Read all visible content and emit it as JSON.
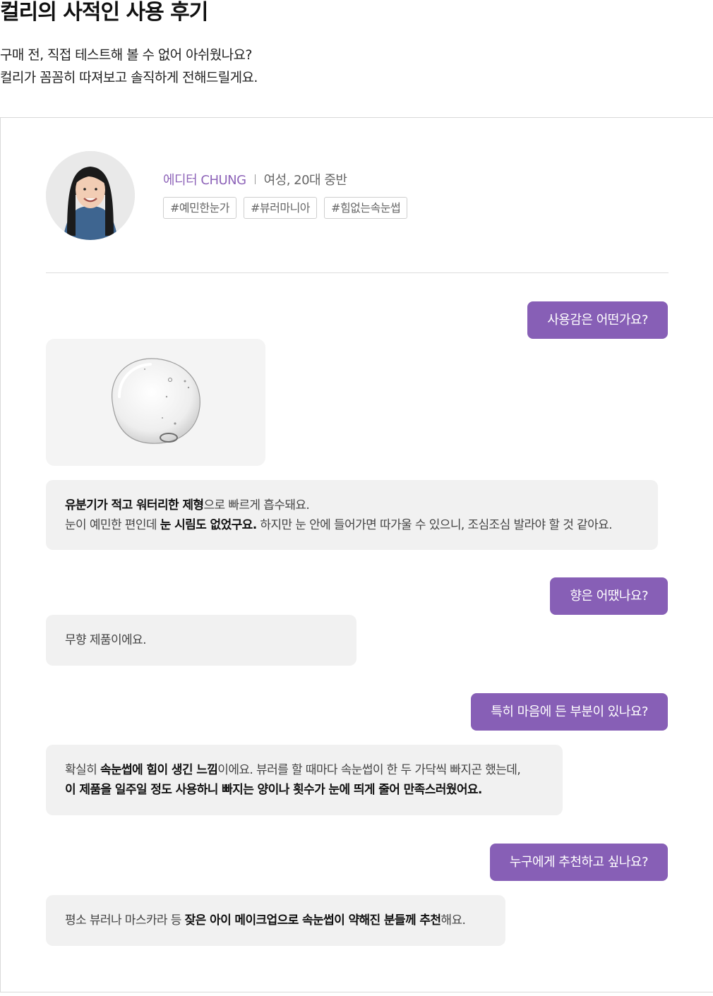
{
  "header": {
    "title": "컬리의 사적인 사용 후기",
    "intro_line1": "구매 전, 직접 테스트해 볼 수 없어 아쉬웠나요?",
    "intro_line2": "컬리가 꼼꼼히 따져보고 솔직하게 전해드릴게요."
  },
  "profile": {
    "name": "에디터 CHUNG",
    "meta": "여성, 20대 중반",
    "tags": [
      "#예민한눈가",
      "#뷰러마니아",
      "#힘없는속눈썹"
    ]
  },
  "colors": {
    "accent": "#875fb6",
    "answer_bg": "#f1f1f1",
    "name_color": "#8e64b9"
  },
  "qa": [
    {
      "question": "사용감은 어떤가요?",
      "answer": [
        [
          {
            "text": "유분기가 적고 워터리한 제형",
            "bold": true
          },
          {
            "text": "으로 빠르게 흡수돼요.",
            "bold": false
          }
        ],
        [
          {
            "text": "눈이 예민한 편인데 ",
            "bold": false
          },
          {
            "text": "눈 시림도 없었구요.",
            "bold": true
          },
          {
            "text": " 하지만 눈 안에 들어가면 따가울 수 있으니, 조심조심 발라야 할 것 같아요.",
            "bold": false
          }
        ]
      ]
    },
    {
      "question": "향은 어땠나요?",
      "answer": [
        [
          {
            "text": "무향 제품이에요.",
            "bold": false
          }
        ]
      ]
    },
    {
      "question": "특히 마음에 든 부분이 있나요?",
      "answer": [
        [
          {
            "text": "확실히 ",
            "bold": false
          },
          {
            "text": "속눈썹에 힘이 생긴 느낌",
            "bold": true
          },
          {
            "text": "이에요. 뷰러를 할 때마다 속눈썹이 한 두 가닥씩 빠지곤 했는데,",
            "bold": false
          }
        ],
        [
          {
            "text": "이 제품을 일주일 정도 사용하니 빠지는 양이나 횟수가 눈에 띄게 줄어 만족스러웠어요.",
            "bold": true
          }
        ]
      ]
    },
    {
      "question": "누구에게 추천하고 싶나요?",
      "answer": [
        [
          {
            "text": "평소 뷰러나 마스카라 등 ",
            "bold": false
          },
          {
            "text": "잦은 아이 메이크업으로 속눈썹이 약해진 분들께 추천",
            "bold": true
          },
          {
            "text": "해요.",
            "bold": false
          }
        ]
      ]
    }
  ]
}
